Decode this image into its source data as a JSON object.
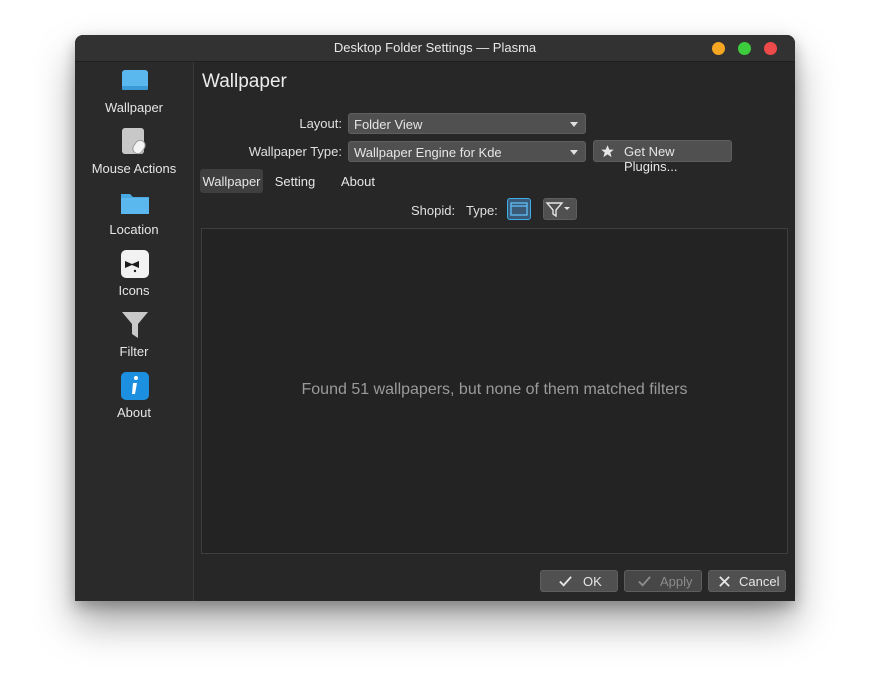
{
  "window": {
    "title": "Desktop Folder Settings — Plasma"
  },
  "sidebar": {
    "items": [
      {
        "label": "Wallpaper",
        "icon": "wallpaper-icon"
      },
      {
        "label": "Mouse Actions",
        "icon": "mouse-actions-icon"
      },
      {
        "label": "Location",
        "icon": "folder-icon"
      },
      {
        "label": "Icons",
        "icon": "icons-icon"
      },
      {
        "label": "Filter",
        "icon": "filter-icon"
      },
      {
        "label": "About",
        "icon": "info-icon"
      }
    ]
  },
  "main": {
    "heading": "Wallpaper",
    "layout": {
      "label": "Layout:",
      "value": "Folder View"
    },
    "wallpaper_type": {
      "label": "Wallpaper Type:",
      "value": "Wallpaper Engine for Kde"
    },
    "get_plugins_label": "Get New Plugins...",
    "tabs": [
      {
        "label": "Wallpaper",
        "active": true
      },
      {
        "label": "Setting",
        "active": false
      },
      {
        "label": "About",
        "active": false
      }
    ],
    "filter_row": {
      "shopid_label": "Shopid:",
      "type_label": "Type:"
    },
    "empty_message": "Found 51 wallpapers, but none of them matched filters"
  },
  "footer": {
    "ok_label": "OK",
    "apply_label": "Apply",
    "cancel_label": "Cancel"
  },
  "colors": {
    "accent": "#3daee9",
    "folder": "#5bb8ee",
    "close": "#ee4a4a",
    "minimize": "#f5a623",
    "maximize": "#3ccc3c"
  }
}
